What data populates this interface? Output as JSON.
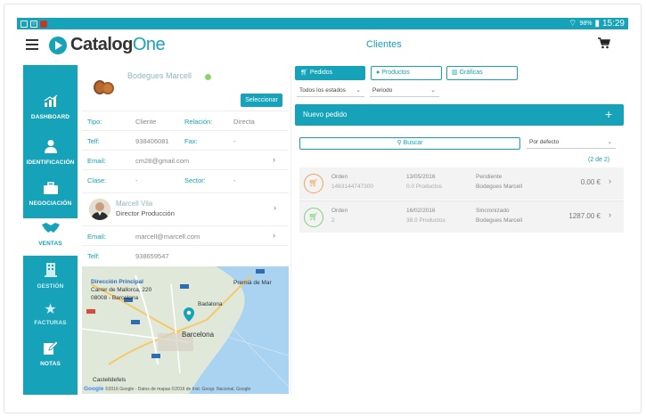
{
  "statusbar": {
    "battery": "98%",
    "time": "15:29"
  },
  "app": {
    "logo_main": "Catalog",
    "logo_accent": "One",
    "page_title": "Clientes"
  },
  "sidebar": {
    "items": [
      {
        "label": "DASHBOARD",
        "icon": "bar-chart-icon"
      },
      {
        "label": "IDENTIFICACIÓN",
        "icon": "user-icon"
      },
      {
        "label": "NEGOCIACIÓN",
        "icon": "briefcase-icon"
      },
      {
        "label": "VENTAS",
        "icon": "handshake-icon"
      },
      {
        "label": "GESTIÓN",
        "icon": "building-icon"
      },
      {
        "label": "FACTURAS",
        "icon": "star-icon"
      },
      {
        "label": "NOTAS",
        "icon": "edit-icon"
      }
    ]
  },
  "client": {
    "name": "Bodegues Marcell",
    "select_label": "Seleccionar",
    "tipo_label": "Tipo:",
    "tipo": "Cliente",
    "relacion_label": "Relación:",
    "relacion": "Directa",
    "telf_label": "Telf:",
    "telf": "938406081",
    "fax_label": "Fax:",
    "fax": "-",
    "email_label": "Email:",
    "email": "cm28@gmail.com",
    "clase_label": "Clase:",
    "clase": "-",
    "sector_label": "Sector:",
    "sector": "-"
  },
  "contact": {
    "name": "Marcell Vila",
    "role": "Director Producción",
    "email_label": "Email:",
    "email": "marcell@marcell.com",
    "telf_label": "Telf:",
    "telf": "938659547"
  },
  "map": {
    "address_title": "Dirección Principal",
    "address_line1": "Carrer de Mallorca, 220",
    "address_line2": "08008 - Barcelona",
    "city": "Barcelona",
    "district1": "Badalona",
    "district2": "Castelldefels",
    "poi": "Premià de Mar",
    "brand": "Google",
    "copyright": "©2016 Google - Datos de mapas ©2016 de Inst. Geogr. Nacional, Google"
  },
  "tabs": [
    {
      "label": "Pedidos"
    },
    {
      "label": "Productos"
    },
    {
      "label": "Gráficas"
    }
  ],
  "filters": {
    "estado": "Todos los estados",
    "periodo": "Periodo"
  },
  "new_order": {
    "label": "Nuevo pedido",
    "plus": "+"
  },
  "search": {
    "label": "Buscar"
  },
  "sort": {
    "label": "Por defecto"
  },
  "results": {
    "count": "(2 de 2)"
  },
  "orders": [
    {
      "label": "Orden",
      "number": "1463144747300",
      "date": "13/05/2016",
      "products": "0.0 Productos",
      "status": "Pendiente",
      "client": "Bodegues Marcell",
      "total": "0.00 €"
    },
    {
      "label": "Orden",
      "number": "2",
      "date": "16/02/2016",
      "products": "38.0 Productos",
      "status": "Sincronizado",
      "client": "Bodegues Marcell",
      "total": "1287.00 €"
    }
  ]
}
